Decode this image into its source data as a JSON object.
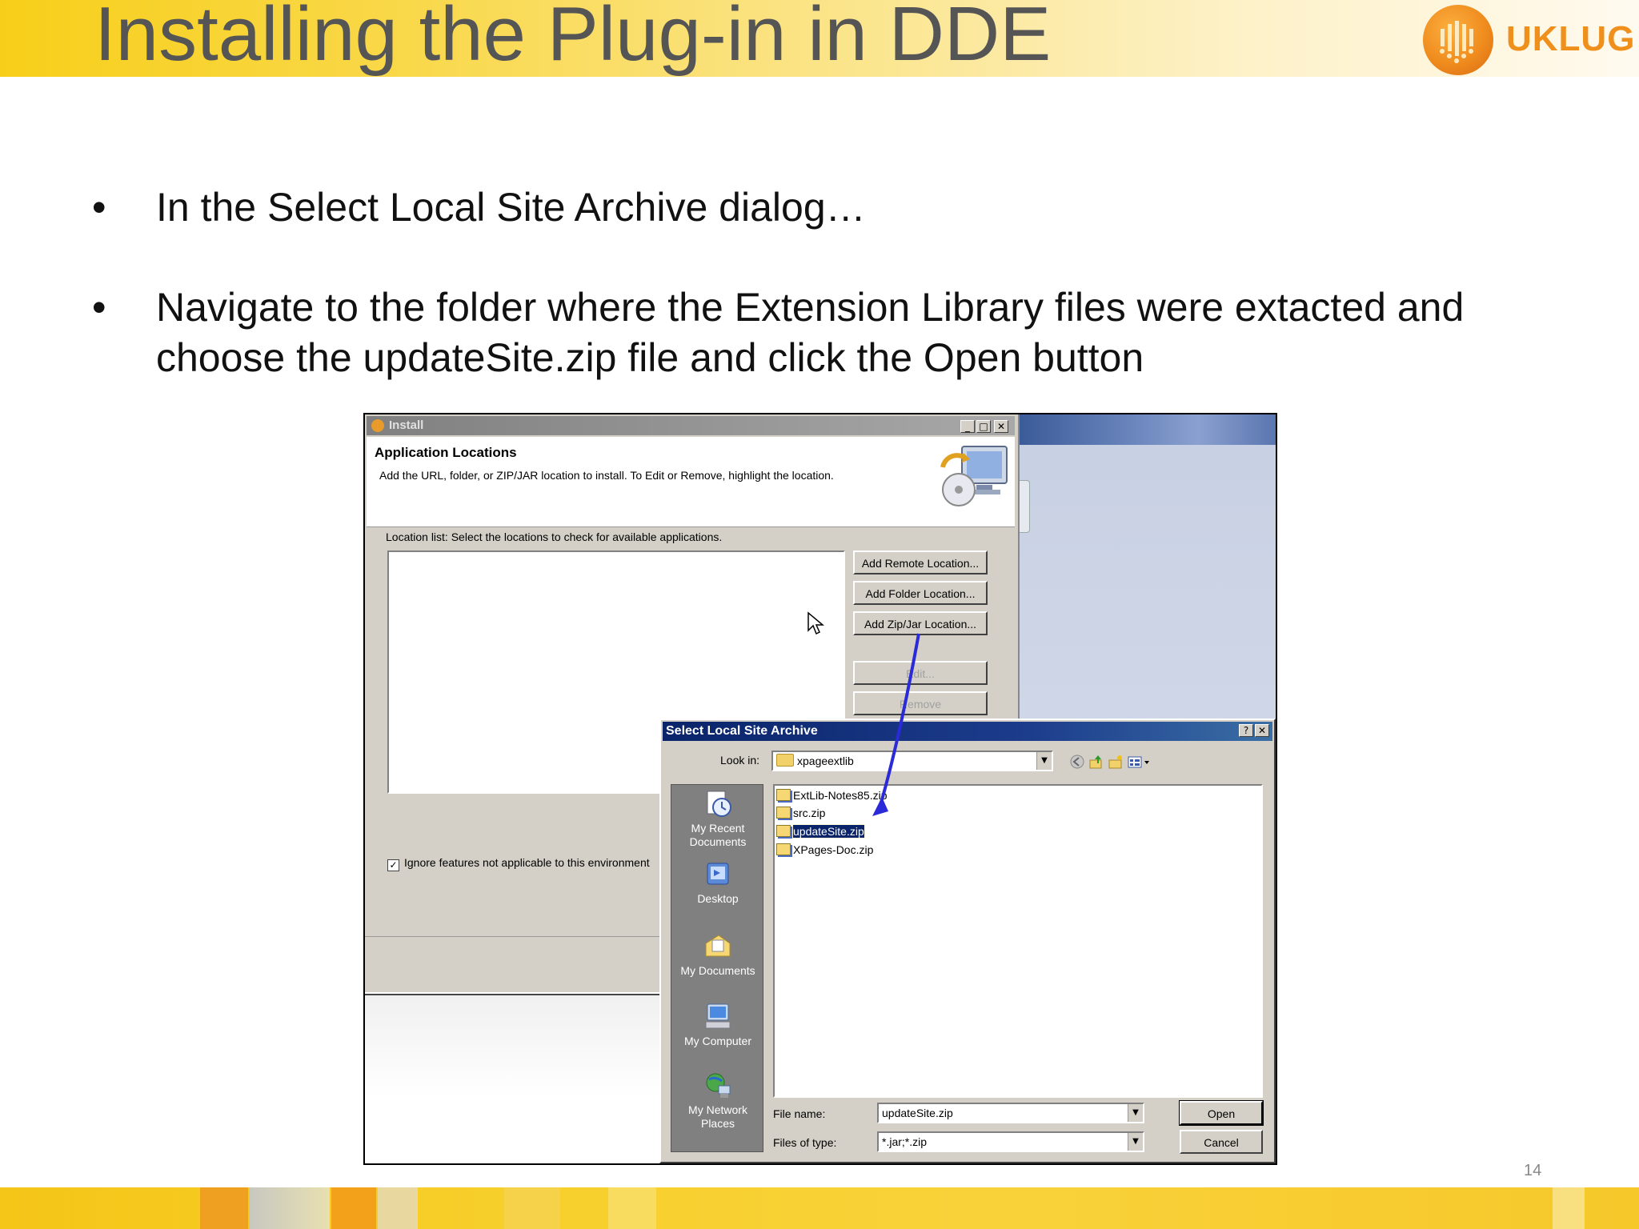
{
  "slide": {
    "title": "Installing the Plug-in in DDE",
    "logo_text": "UKLUG",
    "page_number": "14",
    "bullets": [
      "In the Select Local Site Archive dialog…",
      "Navigate to the folder where the Extension Library files were extacted and choose the updateSite.zip file and click the Open button"
    ]
  },
  "install_dialog": {
    "title": "Install",
    "heading": "Application Locations",
    "description": "Add the URL, folder, or ZIP/JAR location to install. To Edit or Remove, highlight the location.",
    "location_label": "Location list: Select the locations to check for available applications.",
    "buttons": {
      "add_remote": "Add Remote Location...",
      "add_folder": "Add Folder Location...",
      "add_zip": "Add Zip/Jar Location...",
      "edit": "Edit...",
      "remove": "Remove"
    },
    "ignore_label": "Ignore features not applicable to this environment",
    "ignore_checked": true
  },
  "select_dialog": {
    "title": "Select Local Site Archive",
    "look_in_label": "Look in:",
    "look_in_value": "xpageextlib",
    "places": [
      "My Recent Documents",
      "Desktop",
      "My Documents",
      "My Computer",
      "My Network Places"
    ],
    "files": [
      "ExtLib-Notes85.zip",
      "src.zip",
      "updateSite.zip",
      "XPages-Doc.zip"
    ],
    "selected_file": "updateSite.zip",
    "file_name_label": "File name:",
    "file_name_value": "updateSite.zip",
    "file_type_label": "Files of type:",
    "file_type_value": "*.jar;*.zip",
    "open_button": "Open",
    "cancel_button": "Cancel",
    "help_button": "?",
    "close_button": "✕"
  },
  "window_buttons": {
    "minimize": "_",
    "maximize": "□",
    "close": "✕"
  },
  "colors": {
    "header_yellow": "#f7cf1a",
    "title_gray": "#555555",
    "logo_orange": "#f0901c",
    "dialog_titlebar": "#0a246a",
    "annotation_arrow": "#2a2ad8"
  }
}
